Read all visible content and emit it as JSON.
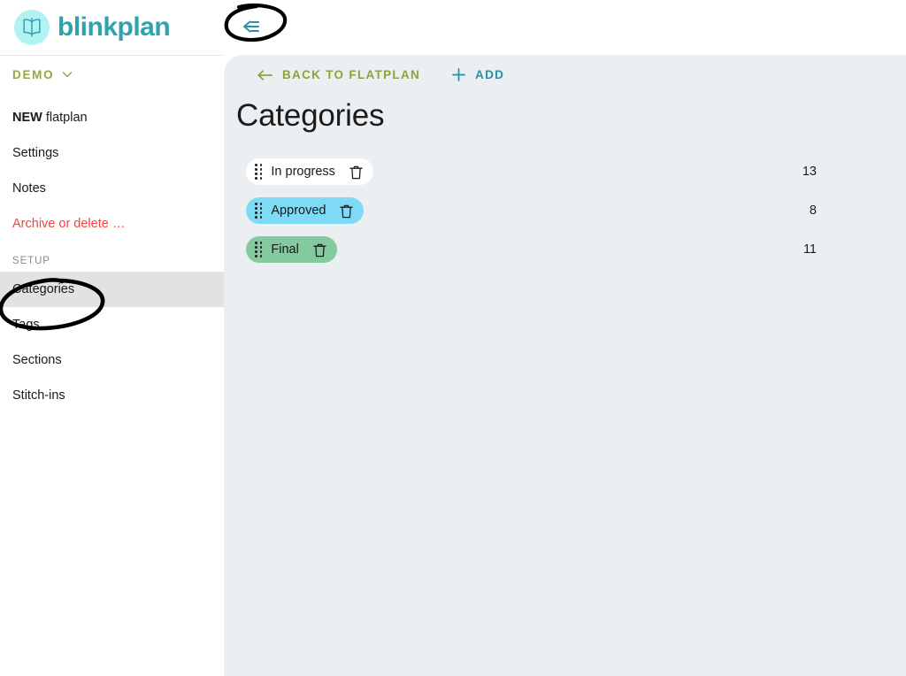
{
  "brand": {
    "name": "blinkplan",
    "logo_icon": "open-book-icon",
    "logo_bg": "#b2f2f2",
    "text_color": "#2fa3ad"
  },
  "sidebar": {
    "org": {
      "label": "DEMO",
      "chevron_icon": "chevron-down-icon",
      "color": "#93a83f"
    },
    "primary_items": [
      {
        "strong": "NEW",
        "label": "flatplan",
        "name": "new-flatplan",
        "danger": false,
        "active": false
      },
      {
        "strong": "",
        "label": "Settings",
        "name": "settings",
        "danger": false,
        "active": false
      },
      {
        "strong": "",
        "label": "Notes",
        "name": "notes",
        "danger": false,
        "active": false
      },
      {
        "strong": "",
        "label": "Archive or delete …",
        "name": "archive-or-delete",
        "danger": true,
        "active": false
      }
    ],
    "setup_label": "SETUP",
    "setup_items": [
      {
        "strong": "",
        "label": "Categories",
        "name": "categories",
        "danger": false,
        "active": true
      },
      {
        "strong": "",
        "label": "Tags",
        "name": "tags",
        "danger": false,
        "active": false
      },
      {
        "strong": "",
        "label": "Sections",
        "name": "sections",
        "danger": false,
        "active": false
      },
      {
        "strong": "",
        "label": "Stitch-ins",
        "name": "stitch-ins",
        "danger": false,
        "active": false
      }
    ]
  },
  "toolbar": {
    "collapse_icon": "collapse-sidebar-icon",
    "back_label": "BACK TO FLATPLAN",
    "back_icon": "arrow-left-icon",
    "back_color": "#8aa33c",
    "add_label": "ADD",
    "add_icon": "plus-icon",
    "add_color": "#2a8fa5"
  },
  "main": {
    "title": "Categories",
    "categories": [
      {
        "label": "In progress",
        "count": "13",
        "color": "#ffffff",
        "drag_icon": "drag-handle-icon",
        "delete_icon": "trash-icon"
      },
      {
        "label": "Approved",
        "count": "8",
        "color": "#7fdbf5",
        "drag_icon": "drag-handle-icon",
        "delete_icon": "trash-icon"
      },
      {
        "label": "Final",
        "count": "11",
        "color": "#85ca9f",
        "drag_icon": "drag-handle-icon",
        "delete_icon": "trash-icon"
      }
    ]
  },
  "annotations": [
    {
      "name": "ellipse-around-collapse-button",
      "shape": "hand-drawn-ellipse",
      "color": "#000000"
    },
    {
      "name": "ellipse-around-categories-nav",
      "shape": "hand-drawn-ellipse",
      "color": "#000000"
    }
  ],
  "colors": {
    "panel_bg": "#ebeff2",
    "sidebar_bg": "#ffffff",
    "active_row": "#e2e2e2"
  }
}
